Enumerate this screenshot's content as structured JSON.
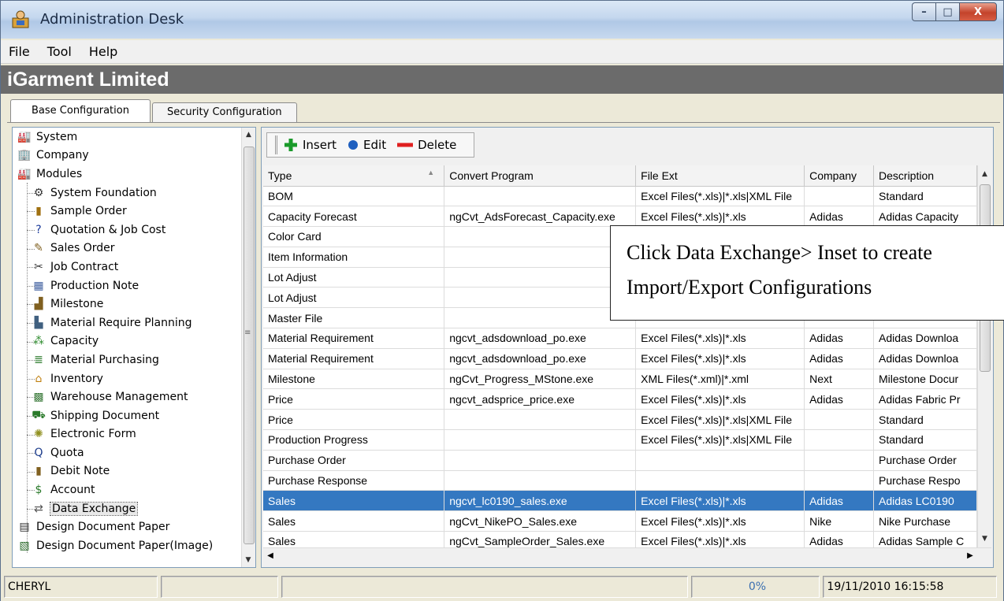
{
  "window": {
    "title": "Administration Desk",
    "min_label": "–",
    "max_label": "□",
    "close_label": "X"
  },
  "menu": [
    {
      "label": "File"
    },
    {
      "label": "Tool"
    },
    {
      "label": "Help"
    }
  ],
  "banner": {
    "title": "iGarment Limited"
  },
  "tabs": [
    {
      "label": "Base Configuration",
      "active": true
    },
    {
      "label": "Security Configuration",
      "active": false
    }
  ],
  "tree": [
    {
      "label": "System",
      "icon": "system-icon",
      "level": 0
    },
    {
      "label": "Company",
      "icon": "company-icon",
      "level": 0
    },
    {
      "label": "Modules",
      "icon": "modules-icon",
      "level": 0
    },
    {
      "label": "System Foundation",
      "icon": "gear-icon",
      "level": 1
    },
    {
      "label": "Sample Order",
      "icon": "sample-order-icon",
      "level": 1
    },
    {
      "label": "Quotation & Job Cost",
      "icon": "question-icon",
      "level": 1
    },
    {
      "label": "Sales Order",
      "icon": "sales-order-icon",
      "level": 1
    },
    {
      "label": "Job Contract",
      "icon": "job-contract-icon",
      "level": 1
    },
    {
      "label": "Production Note",
      "icon": "production-note-icon",
      "level": 1
    },
    {
      "label": "Milestone",
      "icon": "milestone-icon",
      "level": 1
    },
    {
      "label": "Material Require Planning",
      "icon": "mrp-icon",
      "level": 1
    },
    {
      "label": "Capacity",
      "icon": "capacity-icon",
      "level": 1
    },
    {
      "label": "Material Purchasing",
      "icon": "purchasing-icon",
      "level": 1
    },
    {
      "label": "Inventory",
      "icon": "inventory-icon",
      "level": 1
    },
    {
      "label": "Warehouse Management",
      "icon": "warehouse-icon",
      "level": 1
    },
    {
      "label": "Shipping Document",
      "icon": "shipping-icon",
      "level": 1
    },
    {
      "label": "Electronic Form",
      "icon": "form-icon",
      "level": 1
    },
    {
      "label": "Quota",
      "icon": "quota-icon",
      "level": 1
    },
    {
      "label": "Debit Note",
      "icon": "debit-note-icon",
      "level": 1
    },
    {
      "label": "Account",
      "icon": "account-icon",
      "level": 1
    },
    {
      "label": "Data Exchange",
      "icon": "data-exchange-icon",
      "level": 1,
      "selected": true
    },
    {
      "label": "Design Document Paper",
      "icon": "document-icon",
      "level": 0
    },
    {
      "label": "Design Document Paper(Image)",
      "icon": "image-document-icon",
      "level": 0
    }
  ],
  "toolbar": {
    "insert": "Insert",
    "edit": "Edit",
    "delete": "Delete"
  },
  "grid": {
    "columns": [
      "Type",
      "Convert Program",
      "File Ext",
      "Company",
      "Description"
    ],
    "rows": [
      [
        "BOM",
        "",
        "Excel Files(*.xls)|*.xls|XML File",
        "",
        "Standard"
      ],
      [
        "Capacity Forecast",
        "ngCvt_AdsForecast_Capacity.exe",
        "Excel Files(*.xls)|*.xls",
        "Adidas",
        "Adidas Capacity"
      ],
      [
        "Color Card",
        "",
        "",
        "",
        ""
      ],
      [
        "Item Information",
        "",
        "",
        "",
        ""
      ],
      [
        "Lot Adjust",
        "",
        "",
        "",
        ""
      ],
      [
        "Lot Adjust",
        "",
        "",
        "",
        ""
      ],
      [
        "Master File",
        "",
        "",
        "",
        ""
      ],
      [
        "Material Requirement",
        "ngcvt_adsdownload_po.exe",
        "Excel Files(*.xls)|*.xls",
        "Adidas",
        "Adidas Downloa"
      ],
      [
        "Material Requirement",
        "ngcvt_adsdownload_po.exe",
        "Excel Files(*.xls)|*.xls",
        "Adidas",
        "Adidas Downloa"
      ],
      [
        "Milestone",
        "ngCvt_Progress_MStone.exe",
        "XML Files(*.xml)|*.xml",
        "Next",
        "Milestone Docur"
      ],
      [
        "Price",
        "ngcvt_adsprice_price.exe",
        "Excel Files(*.xls)|*.xls",
        "Adidas",
        "Adidas Fabric Pr"
      ],
      [
        "Price",
        "",
        "Excel Files(*.xls)|*.xls|XML File",
        "",
        "Standard"
      ],
      [
        "Production Progress",
        "",
        "Excel Files(*.xls)|*.xls|XML File",
        "",
        "Standard"
      ],
      [
        "Purchase Order",
        "",
        "",
        "",
        "Purchase Order"
      ],
      [
        "Purchase Response",
        "",
        "",
        "",
        "Purchase Respo"
      ],
      [
        "Sales",
        "ngcvt_lc0190_sales.exe",
        "Excel Files(*.xls)|*.xls",
        "Adidas",
        "Adidas LC0190"
      ],
      [
        "Sales",
        "ngCvt_NikePO_Sales.exe",
        "Excel Files(*.xls)|*.xls",
        "Nike",
        "Nike Purchase"
      ],
      [
        "Sales",
        "ngCvt_SampleOrder_Sales.exe",
        "Excel Files(*.xls)|*.xls",
        "Adidas",
        "Adidas Sample C"
      ]
    ],
    "selected_row": 15
  },
  "callout": {
    "line1": "Click Data Exchange> Inset to create",
    "line2": "Import/Export Configurations"
  },
  "status": {
    "user": "CHERYL",
    "progress": "0%",
    "datetime": "19/11/2010 16:15:58"
  },
  "colors": {
    "selection": "#3478c1",
    "banner": "#6b6b6b",
    "insert": "#1a9a2a",
    "edit": "#1f5fbf",
    "delete": "#e02020"
  }
}
